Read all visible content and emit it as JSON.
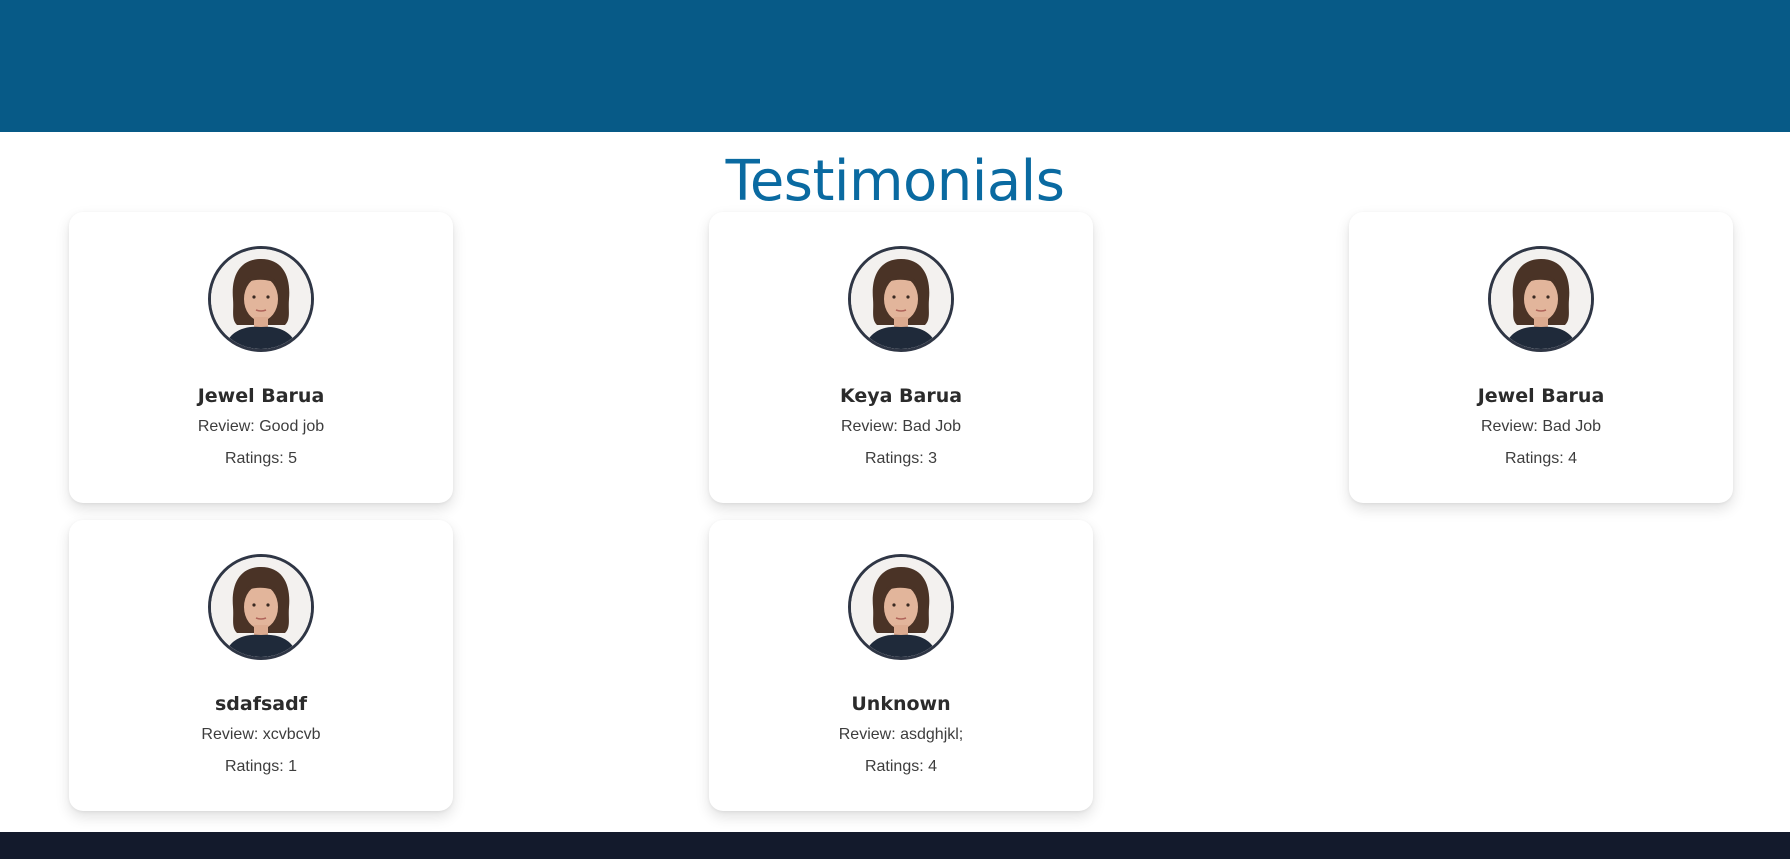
{
  "section": {
    "title": "Testimonials"
  },
  "colors": {
    "header_band": "#075a87",
    "title": "#0a6aa1",
    "footer_band": "#131a2c",
    "avatar_ring": "#2f3645"
  },
  "testimonials": [
    {
      "name": "Jewel Barua",
      "review": "Review: Good job",
      "rating": "Ratings: 5",
      "avatar_icon": "user-photo"
    },
    {
      "name": "Keya Barua",
      "review": "Review: Bad Job",
      "rating": "Ratings: 3",
      "avatar_icon": "user-photo"
    },
    {
      "name": "Jewel Barua",
      "review": "Review: Bad Job",
      "rating": "Ratings: 4",
      "avatar_icon": "user-photo"
    },
    {
      "name": "sdafsadf",
      "review": "Review: xcvbcvb",
      "rating": "Ratings: 1",
      "avatar_icon": "user-photo"
    },
    {
      "name": "Unknown",
      "review": "Review: asdghjkl;",
      "rating": "Ratings: 4",
      "avatar_icon": "user-photo"
    }
  ]
}
